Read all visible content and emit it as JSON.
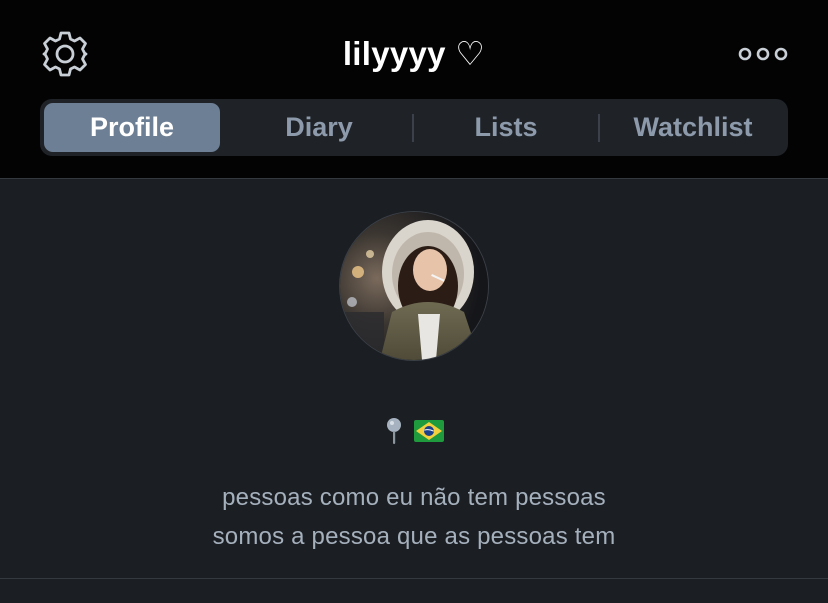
{
  "header": {
    "username": "lilyyyy ♡",
    "settings_icon": "gear-icon",
    "more_icon": "more-dots-icon"
  },
  "tabs": [
    {
      "label": "Profile",
      "active": true
    },
    {
      "label": "Diary",
      "active": false
    },
    {
      "label": "Lists",
      "active": false
    },
    {
      "label": "Watchlist",
      "active": false
    }
  ],
  "profile": {
    "avatar_icon": "avatar",
    "location_icons": [
      "pin-icon",
      "brazil-flag-icon"
    ],
    "bio_lines": [
      "pessoas como eu não tem pessoas",
      "somos a pessoa que as pessoas tem"
    ]
  },
  "colors": {
    "header_bg": "#030303",
    "body_bg": "#1b1e23",
    "tab_active": "#6d7f94",
    "tab_text": "#8d9aab",
    "bio_text": "#a5b0bd"
  }
}
